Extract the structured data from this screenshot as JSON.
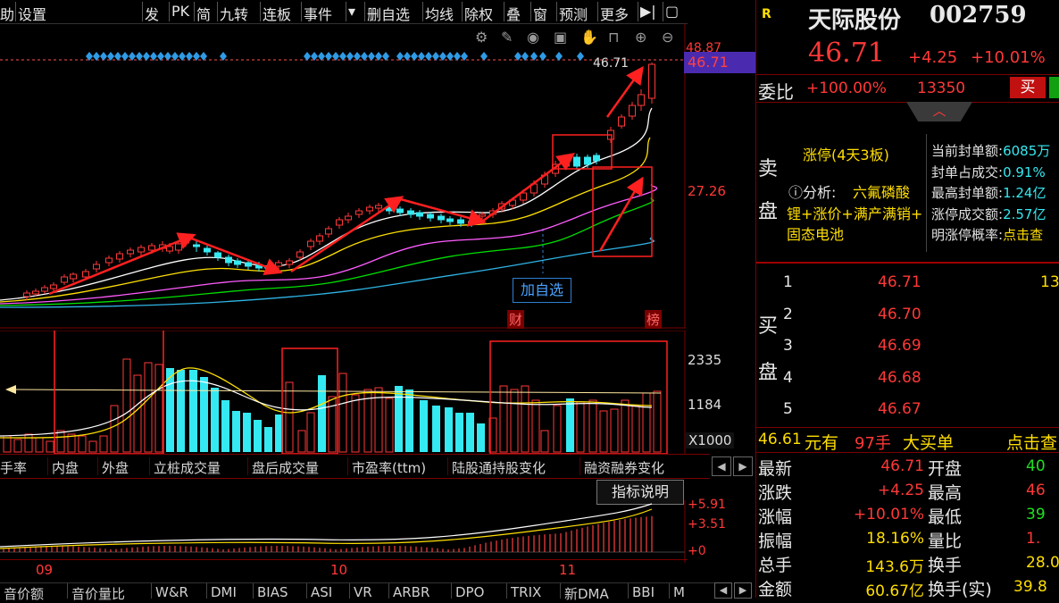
{
  "toolbar": {
    "items": [
      "助",
      "设置",
      "发",
      "PK",
      "简",
      "九转",
      "连板",
      "事件",
      "▾",
      "删自选",
      "均线",
      "除权",
      "叠",
      "窗",
      "预测",
      "更多",
      "▶|",
      "▢"
    ]
  },
  "price_axis": {
    "top_label": "48.87",
    "current": "46.71",
    "mid": "27.26",
    "last_label": "46.71"
  },
  "chart_markers": {
    "add_watch": "加自选",
    "cai": "财",
    "bang": "榜"
  },
  "volume_axis": {
    "high": "2335",
    "mid": "1184",
    "unit": "X1000"
  },
  "tabs": [
    "手率",
    "内盘",
    "外盘",
    "立桩成交量",
    "盘后成交量",
    "市盈率(ttm)",
    "陆股通持股变化",
    "融资融券变化"
  ],
  "indicator_button": "指标说明",
  "macd_axis": {
    "v1": "+5.91",
    "v2": "+3.51",
    "v3": "+0"
  },
  "months": [
    "09",
    "10",
    "11"
  ],
  "bottom_tabs": [
    "音价额",
    "音价量比",
    "W&R",
    "DMI",
    "BIAS",
    "ASI",
    "VR",
    "ARBR",
    "DPO",
    "TRIX",
    "新DMA",
    "BBI",
    "M"
  ],
  "stock": {
    "badge": "R",
    "name": "天际股份",
    "code": "002759",
    "price": "46.71",
    "change": "+4.25",
    "change_pct": "+10.01%",
    "weibi_label": "委比",
    "weibi_value": "+100.00%",
    "weibi_qty": "13350",
    "buy_btn": "买"
  },
  "limit_info": {
    "sell_label": [
      "卖",
      "盘"
    ],
    "status": "涨停(4天3板)",
    "analysis_label": "ⓘ分析:",
    "analysis_text": [
      "六氟磷酸",
      "锂+涨价+满产满销+",
      "固态电池"
    ],
    "rows": [
      {
        "label": "当前封单额:",
        "value": "6085万"
      },
      {
        "label": "封单占成交:",
        "value": "0.91%"
      },
      {
        "label": "最高封单额:",
        "value": "1.24亿"
      },
      {
        "label": "涨停成交额:",
        "value": "2.57亿"
      },
      {
        "label": "明涨停概率:",
        "value": "点击查"
      }
    ]
  },
  "buy_book": {
    "label": [
      "买",
      "盘"
    ],
    "levels": [
      {
        "n": "1",
        "price": "46.71",
        "qty": "13"
      },
      {
        "n": "2",
        "price": "46.70",
        "qty": ""
      },
      {
        "n": "3",
        "price": "46.69",
        "qty": ""
      },
      {
        "n": "4",
        "price": "46.68",
        "qty": ""
      },
      {
        "n": "5",
        "price": "46.67",
        "qty": ""
      }
    ]
  },
  "big_order": {
    "price": "46.61",
    "text1": "元有",
    "qty": "97手",
    "text2": "大买单",
    "click": "点击查"
  },
  "stats_left": [
    {
      "label": "最新",
      "value": "46.71",
      "color": "red"
    },
    {
      "label": "涨跌",
      "value": "+4.25",
      "color": "red"
    },
    {
      "label": "涨幅",
      "value": "+10.01%",
      "color": "red"
    },
    {
      "label": "振幅",
      "value": "18.16%",
      "color": "yellow"
    },
    {
      "label": "总手",
      "value": "143.6万",
      "color": "yellow"
    },
    {
      "label": "金额",
      "value": "60.67亿",
      "color": "yellow"
    }
  ],
  "stats_right": [
    {
      "label": "开盘",
      "value": "40",
      "color": "green"
    },
    {
      "label": "最高",
      "value": "46",
      "color": "red"
    },
    {
      "label": "最低",
      "value": "39",
      "color": "green"
    },
    {
      "label": "量比",
      "value": "1.",
      "color": "red"
    },
    {
      "label": "换手",
      "value": "28.0",
      "color": "yellow"
    },
    {
      "label": "换手(实)",
      "value": "39.8",
      "color": "yellow"
    }
  ],
  "colors": {
    "up": "#ff3838",
    "down": "#35e9f2",
    "frame": "#7a0000",
    "ma1": "#ffffff",
    "ma2": "#ffe000",
    "ma3": "#ff5cff",
    "ma4": "#00e000",
    "ma5": "#2fb4e6"
  }
}
